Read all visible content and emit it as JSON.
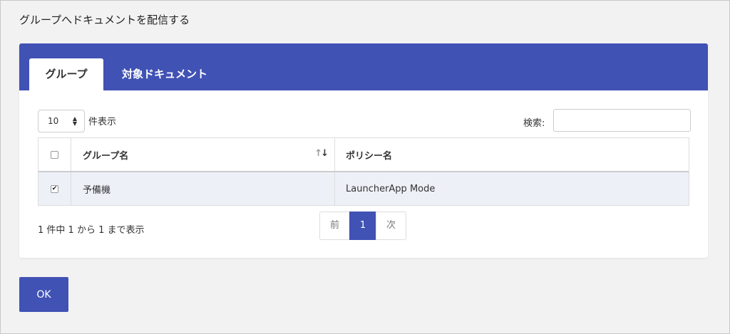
{
  "dialog": {
    "title": "グループへドキュメントを配信する",
    "ok_label": "OK"
  },
  "tabs": [
    {
      "label": "グループ",
      "active": true
    },
    {
      "label": "対象ドキュメント",
      "active": false
    }
  ],
  "table_controls": {
    "page_length": "10",
    "page_length_label": "件表示",
    "search_label": "検索:",
    "search_value": ""
  },
  "table": {
    "columns": [
      "グループ名",
      "ポリシー名"
    ],
    "rows": [
      {
        "checked": true,
        "group": "予備機",
        "policy": "LauncherApp Mode"
      }
    ]
  },
  "pagination": {
    "info": "1 件中 1 から 1 まで表示",
    "prev_label": "前",
    "current_page": "1",
    "next_label": "次"
  },
  "colors": {
    "accent": "#4152b5",
    "row_selected": "#eef0f8"
  },
  "icons": {
    "sort": "sort-icon",
    "select_arrows": "select-arrows-icon"
  }
}
